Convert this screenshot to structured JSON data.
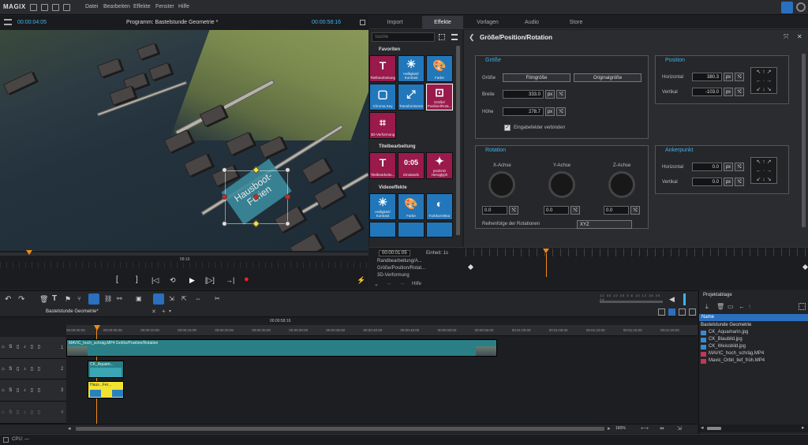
{
  "app": {
    "logo": "MAGIX",
    "menu": [
      "Datei",
      "Bearbeiten",
      "Effekte",
      "Fenster",
      "Hilfe"
    ]
  },
  "preview": {
    "time_left": "00:00:04:05",
    "program_title": "Programm: Bastelstunde Geometrie *",
    "time_right": "00:00:58:16",
    "title_text": "Hausboot-Ferien",
    "scrub_label": "58:16",
    "transport": [
      "[",
      "]",
      "|◁",
      "⟲",
      "▶",
      "[▷]",
      "→|",
      "●",
      "⚡"
    ]
  },
  "tabs": [
    "Import",
    "Effekte",
    "Vorlagen",
    "Audio",
    "Store"
  ],
  "effects": {
    "search_placeholder": "Suche",
    "sections": [
      {
        "title": "Favoriten",
        "tiles": [
          {
            "label": "Titelbearbeitung",
            "icon": "T",
            "color": "mag"
          },
          {
            "label": "Helligkeit/ Kontrast",
            "icon": "☀",
            "color": "blu"
          },
          {
            "label": "Farbe",
            "icon": "🎨",
            "color": "blu"
          },
          {
            "label": "Chroma Key",
            "icon": "▢",
            "color": "blu"
          },
          {
            "label": "Transformieren",
            "icon": "⤢",
            "color": "blu"
          },
          {
            "label": "Größe/ Position/Rota...",
            "icon": "⊡",
            "color": "mag"
          },
          {
            "label": "3D-Verformung",
            "icon": "⌗",
            "color": "mag"
          }
        ]
      },
      {
        "title": "Titelbearbeitung",
        "tiles": [
          {
            "label": "Titelbearbeitu...",
            "icon": "T",
            "color": "mag"
          },
          {
            "label": "Einstands",
            "icon": "0:05",
            "color": "mag"
          },
          {
            "label": "proDAD Heroglyph",
            "icon": "✦",
            "color": "mag"
          }
        ]
      },
      {
        "title": "Videoeffekte",
        "tiles": [
          {
            "label": "Helligkeit/ Kontrast",
            "icon": "☀",
            "color": "blu"
          },
          {
            "label": "Farbe",
            "icon": "🎨",
            "color": "blu"
          },
          {
            "label": "Farbkorrektur",
            "icon": "◐",
            "color": "blu"
          }
        ]
      }
    ]
  },
  "props": {
    "title": "Größe/Position/Rotation",
    "groesse": {
      "title": "Größe",
      "label_size": "Größe",
      "btn_film": "Filmgröße",
      "btn_orig": "Originalgröße",
      "label_width": "Breite",
      "width_value": "333.0",
      "label_height": "Höhe",
      "height_value": "278.7",
      "unit": "px",
      "link_label": "Eingabefelder verbinden"
    },
    "position": {
      "title": "Position",
      "label_h": "Horizontal",
      "h_value": "380.3",
      "label_v": "Vertikal",
      "v_value": "-103.0",
      "unit": "px"
    },
    "rotation": {
      "title": "Rotation",
      "axes": [
        "X-Achse",
        "Y-Achse",
        "Z-Achse"
      ],
      "values": [
        "0.0",
        "0.0",
        "0.0"
      ],
      "order_label": "Reihenfolge der Rotationen",
      "order_value": "XYZ"
    },
    "anker": {
      "title": "Ankerpunkt",
      "label_h": "Horizontal",
      "h_value": "0.0",
      "label_v": "Vertikal",
      "v_value": "0.0",
      "unit": "px"
    }
  },
  "keyframes": {
    "time": "00:00:01:05",
    "unit_label": "Einheit: 1s",
    "rows": [
      "Randbearbeitung/A...",
      "Größe/Position/Rotat...",
      "3D-Verformung"
    ],
    "help": "Hilfe"
  },
  "timeline": {
    "project_tab": "Bastelstunde Geometrie*",
    "time_center": "00:00:58:16",
    "ruler_ticks": [
      "00:00:00:00",
      "00:00:05:00",
      "00:00:10:00",
      "00:00:15:00",
      "00:00:20:00",
      "00:00:25:00",
      "00:00:30:00",
      "00:00:35:00",
      "00:00:40:00",
      "00:00:45:00",
      "00:00:50:00",
      "00:00:55:00",
      "00:01:00:00",
      "00:01:05:00",
      "00:01:10:00",
      "00:01:15:00",
      "00:01:20:00"
    ],
    "tracks": [
      {
        "num": "1",
        "clip": "MAVIC_hoch_schräg.MP4   Größe/Position/Rotation"
      },
      {
        "num": "2",
        "clip": "CK_Aquam..."
      },
      {
        "num": "3",
        "clip": "Haus...Fer..."
      },
      {
        "num": "4",
        "clip": ""
      }
    ],
    "zoom": "160%",
    "scale_ticks": [
      "12",
      "30",
      "10",
      "20",
      "3",
      "6",
      "10",
      "12",
      "16",
      "20",
      "24"
    ]
  },
  "project": {
    "title": "Projektablage",
    "col": "Name",
    "root": "Bastelstunde Geometrie",
    "files": [
      "CK_Aquamarin.jpg",
      "CK_Blaubild.jpg",
      "CK_Weissbild.jpg",
      "MAVIC_hoch_schräg.MP4",
      "Mavic_Orbit_tief_früh.MP4"
    ]
  },
  "status": {
    "cpu": "CPU: —"
  },
  "colors": {
    "accent": "#3fb3e8",
    "magenta": "#9a1a4c",
    "blue": "#2277bb",
    "playhead": "#f08a1c"
  }
}
